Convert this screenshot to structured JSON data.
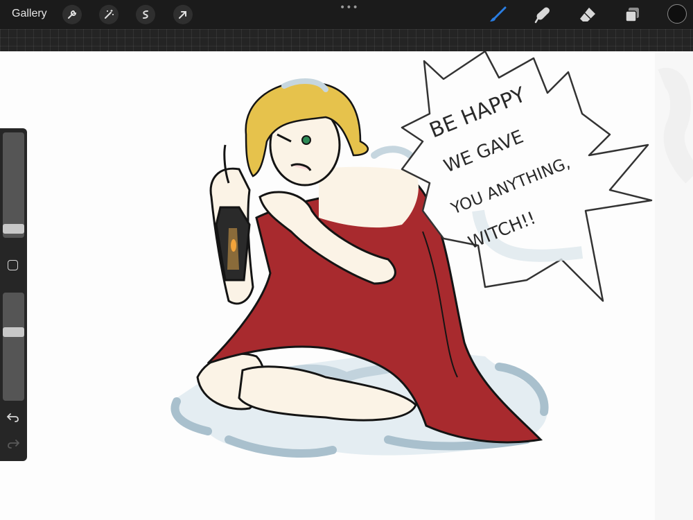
{
  "topbar": {
    "gallery_label": "Gallery",
    "more_dots": "•••",
    "left_tools": [
      "wrench-icon",
      "magic-wand-icon",
      "selection-icon",
      "transform-arrow-icon"
    ],
    "right_tools": [
      "brush-icon",
      "smudge-icon",
      "eraser-icon",
      "layers-icon"
    ],
    "active_tool_color": "#2a7de1",
    "current_color": "#0f0f0f"
  },
  "canvas": {
    "speech_bubble_text": [
      "BE HAPPY",
      "WE GAVE",
      "YOU ANYTHING,",
      "WITCH!!"
    ],
    "colors": {
      "hair": "#e6c24c",
      "cloak": "#a82a2e",
      "skin": "#fbf3e6",
      "snow": "#c6d6df",
      "ink": "#141414"
    }
  },
  "sidebar": {
    "brush_size_level": 0.9,
    "opacity_level": 0.35,
    "modify_button": "square-modify-icon",
    "undo_icon": "undo-icon",
    "redo_icon": "redo-icon"
  }
}
